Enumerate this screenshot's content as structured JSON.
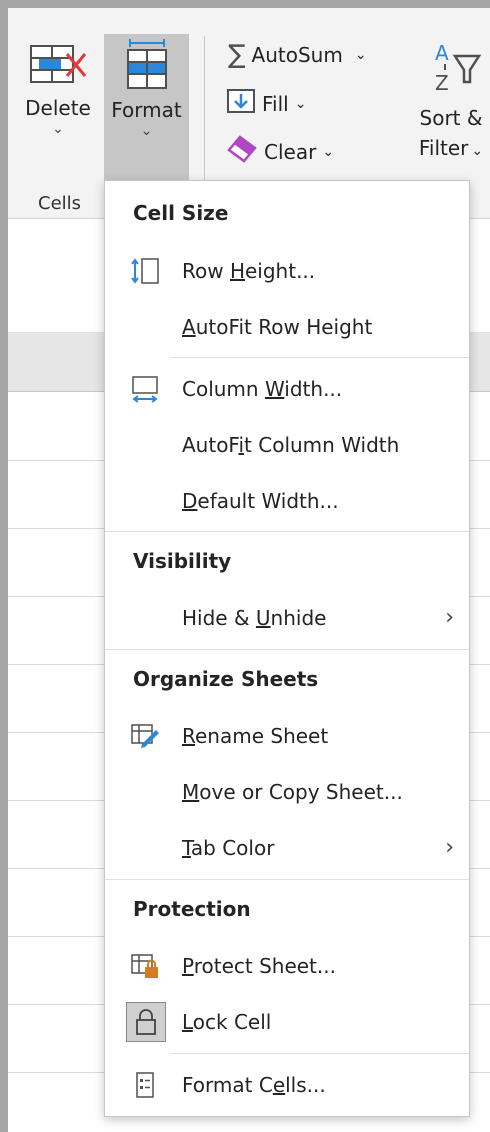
{
  "ribbon": {
    "cells_group": {
      "label": "Cells",
      "delete": {
        "label": "Delete",
        "icon": "delete-cells-icon"
      },
      "format": {
        "label": "Format",
        "icon": "format-cells-icon"
      }
    },
    "editing_group": {
      "autosum": {
        "label": "AutoSum",
        "icon": "sigma-icon"
      },
      "fill": {
        "label": "Fill",
        "icon": "fill-down-icon"
      },
      "clear": {
        "label": "Clear",
        "icon": "eraser-icon"
      },
      "sort_filter": {
        "label_line1": "Sort &",
        "label_line2": "Filter",
        "icon": "sort-filter-icon"
      }
    }
  },
  "menu": {
    "sections": {
      "cell_size": "Cell Size",
      "visibility": "Visibility",
      "organize": "Organize Sheets",
      "protection": "Protection"
    },
    "items": {
      "row_height": {
        "pre": "Row ",
        "acc": "H",
        "post": "eight..."
      },
      "autofit_row": {
        "pre": "",
        "acc": "A",
        "post": "utoFit Row Height"
      },
      "column_width": {
        "pre": "Column ",
        "acc": "W",
        "post": "idth..."
      },
      "autofit_col": {
        "pre": "AutoF",
        "acc": "i",
        "post": "t Column Width"
      },
      "default_width": {
        "pre": "",
        "acc": "D",
        "post": "efault Width..."
      },
      "hide_unhide": {
        "pre": "Hide & ",
        "acc": "U",
        "post": "nhide"
      },
      "rename_sheet": {
        "pre": "",
        "acc": "R",
        "post": "ename Sheet"
      },
      "move_copy": {
        "pre": "",
        "acc": "M",
        "post": "ove or Copy Sheet..."
      },
      "tab_color": {
        "pre": "",
        "acc": "T",
        "post": "ab Color"
      },
      "protect_sheet": {
        "pre": "",
        "acc": "P",
        "post": "rotect Sheet..."
      },
      "lock_cell": {
        "pre": "",
        "acc": "L",
        "post": "ock Cell"
      },
      "format_cells": {
        "pre": "Format C",
        "acc": "e",
        "post": "lls..."
      }
    },
    "submenu_arrow": "›"
  },
  "colors": {
    "accent_blue": "#2b88d8",
    "lock_orange": "#d87b1e",
    "eraser_purple": "#b146c2",
    "delete_red": "#e0393e"
  }
}
